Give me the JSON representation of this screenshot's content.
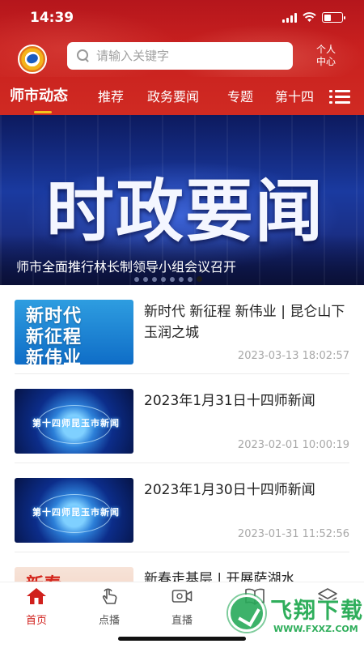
{
  "status_bar": {
    "time": "14:39",
    "battery_level": 0.4
  },
  "header": {
    "search_placeholder": "请输入关键字",
    "user_center_line1": "个人",
    "user_center_line2": "中心"
  },
  "tabs": {
    "items": [
      {
        "label": "师市动态",
        "active": true
      },
      {
        "label": "推荐"
      },
      {
        "label": "政务要闻"
      },
      {
        "label": "专题"
      },
      {
        "label": "第十四"
      }
    ],
    "accent_color": "#f3c41e"
  },
  "banner": {
    "headline": "时政要闻",
    "caption": "师市全面推行林长制领导小组会议召开",
    "slide_count": 8,
    "active_slide": 8
  },
  "news": [
    {
      "title": "新时代 新征程 新伟业 | 昆仑山下 玉润之城",
      "date": "2023-03-13 18:02:57",
      "thumb_lines": [
        "新时代",
        "新征程",
        "新伟业"
      ]
    },
    {
      "title": "2023年1月31日十四师新闻",
      "date": "2023-02-01 10:00:19",
      "thumb_text": "第十四师昆玉市新闻"
    },
    {
      "title": "2023年1月30日十四师新闻",
      "date": "2023-01-31 11:52:56",
      "thumb_text": "第十四师昆玉市新闻"
    },
    {
      "title": "新春走基层 | 开展萨湖水",
      "thumb_text": "新春"
    }
  ],
  "bottom_nav": [
    {
      "label": "首页",
      "icon": "home-icon",
      "active": true
    },
    {
      "label": "点播",
      "icon": "tap-hand-icon"
    },
    {
      "label": "直播",
      "icon": "video-camera-icon"
    },
    {
      "label": "",
      "icon": "book-icon"
    },
    {
      "label": "",
      "icon": "layers-icon"
    }
  ],
  "watermark": {
    "title": "飞翔下载",
    "url": "WWW.FXXZ.COM"
  },
  "colors": {
    "brand_red": "#c8201f",
    "active_nav": "#d0201c"
  }
}
